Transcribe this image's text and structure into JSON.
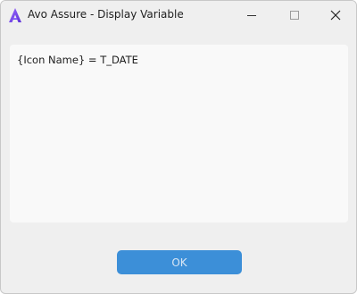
{
  "window": {
    "title": "Avo Assure - Display Variable"
  },
  "icons": {
    "app": "avo-assure-logo-icon",
    "minimize": "minimize-icon",
    "maximize": "maximize-icon",
    "close": "close-icon"
  },
  "content": {
    "text": "{Icon Name} = T_DATE"
  },
  "buttons": {
    "ok_label": "OK"
  },
  "colors": {
    "accent": "#3c8fd8",
    "logo": "#7b4dfa"
  }
}
